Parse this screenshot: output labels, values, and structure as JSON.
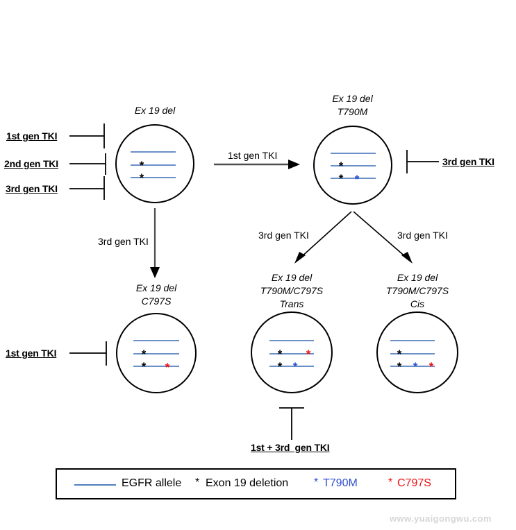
{
  "figure": {
    "type": "diagram",
    "subject": "EGFR TKI resistance evolution schematic"
  },
  "cells": [
    {
      "id": "cell-ex19del",
      "title_lines": [
        "Ex 19 del"
      ],
      "alleles": [
        {
          "markers": []
        },
        {
          "markers": [
            "exon19del"
          ]
        },
        {
          "markers": [
            "exon19del"
          ]
        }
      ]
    },
    {
      "id": "cell-ex19del-t790m",
      "title_lines": [
        "Ex 19 del",
        "T790M"
      ],
      "alleles": [
        {
          "markers": []
        },
        {
          "markers": [
            "exon19del"
          ]
        },
        {
          "markers": [
            "exon19del",
            "t790m"
          ]
        }
      ]
    },
    {
      "id": "cell-ex19del-c797s",
      "title_lines": [
        "Ex 19 del",
        "C797S"
      ],
      "alleles": [
        {
          "markers": []
        },
        {
          "markers": [
            "exon19del"
          ]
        },
        {
          "markers": [
            "exon19del",
            "c797s"
          ]
        }
      ]
    },
    {
      "id": "cell-trans",
      "title_lines": [
        "Ex 19 del",
        "T790M/C797S",
        "Trans"
      ],
      "alleles": [
        {
          "markers": []
        },
        {
          "markers": [
            "exon19del",
            "c797s"
          ]
        },
        {
          "markers": [
            "exon19del",
            "t790m"
          ]
        }
      ]
    },
    {
      "id": "cell-cis",
      "title_lines": [
        "Ex 19 del",
        "T790M/C797S",
        "Cis"
      ],
      "alleles": [
        {
          "markers": []
        },
        {
          "markers": [
            "exon19del"
          ]
        },
        {
          "markers": [
            "exon19del",
            "t790m",
            "c797s"
          ]
        }
      ]
    }
  ],
  "labels": {
    "inhibit_top_left_1": "1st gen TKI",
    "inhibit_top_left_2": "2nd gen TKI",
    "inhibit_top_left_3": "3rd gen TKI",
    "arrow_right_top": "1st gen TKI",
    "inhibit_top_right": "3rd gen TKI",
    "arrow_down_left": "3rd gen TKI",
    "arrow_branch_left": "3rd gen TKI",
    "arrow_branch_right": "3rd gen TKI",
    "inhibit_bottom_left": "1st gen TKI",
    "inhibit_bottom_center": "1st + 3rd  gen TKI"
  },
  "titles": {
    "cell1": "Ex 19 del",
    "cell2_line1": "Ex 19 del",
    "cell2_line2": "T790M",
    "cell3_line1": "Ex 19 del",
    "cell3_line2": "C797S",
    "cell4_line1": "Ex 19 del",
    "cell4_line2": "T790M/C797S",
    "cell4_line3": "Trans",
    "cell5_line1": "Ex 19 del",
    "cell5_line2": "T790M/C797S",
    "cell5_line3": "Cis"
  },
  "legend": {
    "allele_label": "EGFR allele",
    "exon19_star": "*",
    "exon19_label": "Exon 19 deletion",
    "t790m_star": "*",
    "t790m_label": "T790M",
    "c797s_star": "*",
    "c797s_label": "C797S"
  },
  "colors": {
    "allele_line": "#3a6bb5",
    "exon19del": "#000000",
    "t790m": "#2f4fd0",
    "c797s": "#ee1111",
    "cell_outline": "#000000",
    "arrow": "#4d4d4d",
    "watermark": "#d6d6d6"
  },
  "watermark": {
    "text": "www.yuaigongwu.com"
  }
}
